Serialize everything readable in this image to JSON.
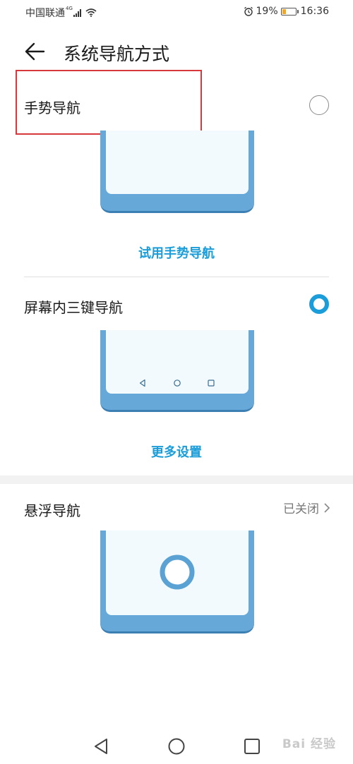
{
  "status_bar": {
    "carrier": "中国联通",
    "network": "4G",
    "battery_percent": "19%",
    "time": "16:36",
    "battery_color": "#f5a623"
  },
  "header": {
    "title": "系统导航方式",
    "back_icon": "arrow-left-icon"
  },
  "options": [
    {
      "label": "手势导航",
      "selected": false,
      "action_label": "试用手势导航"
    },
    {
      "label": "屏幕内三键导航",
      "selected": true,
      "action_label": "更多设置"
    }
  ],
  "floating_nav": {
    "label": "悬浮导航",
    "status": "已关闭"
  },
  "watermark": "Bai 经验",
  "colors": {
    "accent": "#1b9dd9",
    "highlight_border": "#d6383b",
    "phone_body": "#66a8d8"
  }
}
